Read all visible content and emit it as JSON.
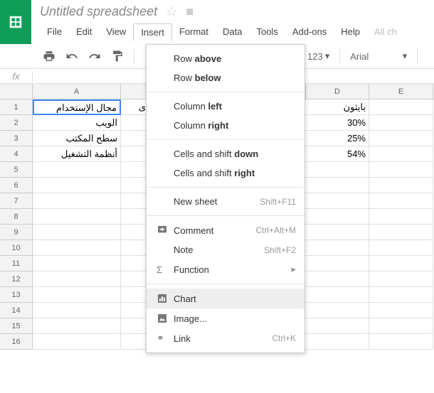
{
  "doc_title": "Untitled spreadsheet",
  "menubar": {
    "file": "File",
    "edit": "Edit",
    "view": "View",
    "insert": "Insert",
    "format": "Format",
    "data": "Data",
    "tools": "Tools",
    "addons": "Add-ons",
    "help": "Help"
  },
  "all_changes": "All ch",
  "toolbar": {
    "num": "123",
    "font": "Arial"
  },
  "fx": "fx",
  "columns": {
    "a": "A",
    "d": "D",
    "e": "E"
  },
  "row_nums": [
    "1",
    "2",
    "3",
    "4",
    "5",
    "6",
    "7",
    "8",
    "9",
    "10",
    "11",
    "12",
    "13",
    "14",
    "15",
    "16"
  ],
  "cells": {
    "a1": "مجال الإستخدام",
    "a2": "الويب",
    "a3": "سطح المكتب",
    "a4": "أنظمة التشغيل",
    "d1": "بايثون",
    "d2": "30%",
    "d3": "25%",
    "d4": "54%"
  },
  "menu": {
    "row_above_pre": "Row ",
    "row_above_b": "above",
    "row_below_pre": "Row ",
    "row_below_b": "below",
    "col_left_pre": "Column ",
    "col_left_b": "left",
    "col_right_pre": "Column ",
    "col_right_b": "right",
    "cells_down_pre": "Cells and shift ",
    "cells_down_b": "down",
    "cells_right_pre": "Cells and shift ",
    "cells_right_b": "right",
    "new_sheet": "New sheet",
    "new_sheet_sc": "Shift+F11",
    "comment": "Comment",
    "comment_sc": "Ctrl+Alt+M",
    "note": "Note",
    "note_sc": "Shift+F2",
    "function": "Function",
    "chart": "Chart",
    "image": "Image...",
    "link": "Link",
    "link_sc": "Ctrl+K"
  }
}
